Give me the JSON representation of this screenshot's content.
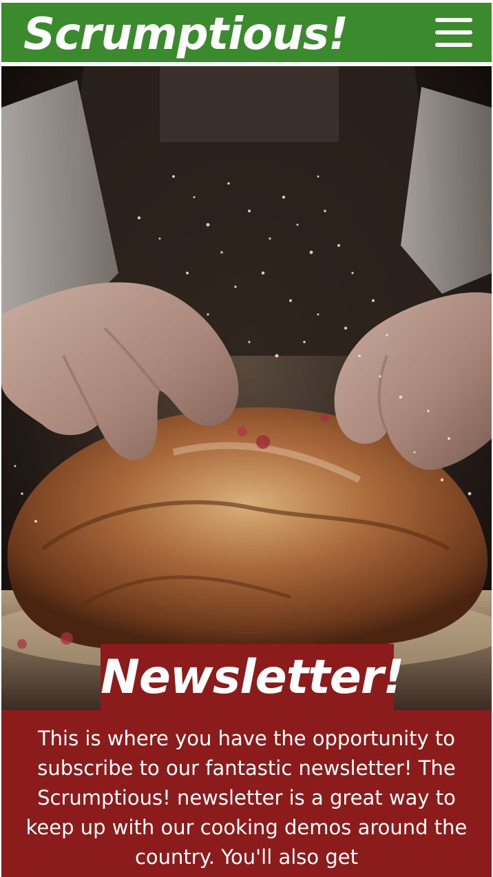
{
  "header": {
    "title": "Scrumptious!",
    "menu_icon": "hamburger-menu-icon",
    "background_color": "#3b8a2e"
  },
  "hero": {
    "image_subject": "baker kneading flour-dusted bread dough"
  },
  "newsletter": {
    "heading": "Newsletter!",
    "body": "This is where you have the opportunity to subscribe to our fantastic newsletter! The Scrumptious! newsletter is a great way to keep up with our cooking demos around the country. You'll also get",
    "background_color": "#8c1c1c"
  }
}
